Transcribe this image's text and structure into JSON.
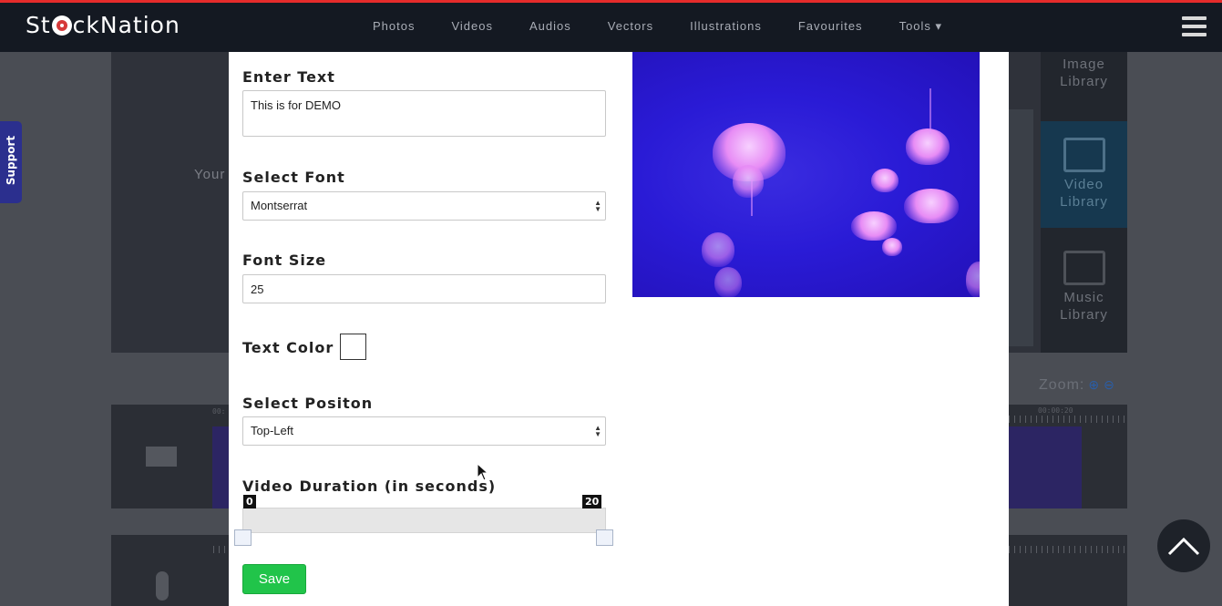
{
  "header": {
    "logo_text_pre": "St",
    "logo_text_post": "ckNation",
    "nav": [
      "Photos",
      "Videos",
      "Audios",
      "Vectors",
      "Illustrations",
      "Favourites",
      "Tools ▾"
    ]
  },
  "support_label": "Support",
  "background": {
    "left_text": "Your",
    "libraries": [
      "Image Library",
      "Video Library",
      "Music Library"
    ],
    "active_library": "Video Library",
    "zoom_label": "Zoom:",
    "time_left": "00:",
    "time_right": "00:00:20"
  },
  "form": {
    "enter_text_label": "Enter Text",
    "enter_text_value": "This is for DEMO",
    "select_font_label": "Select Font",
    "select_font_value": "Montserrat",
    "font_size_label": "Font Size",
    "font_size_value": "25",
    "text_color_label": "Text Color",
    "text_color_value": "#ffffff",
    "select_position_label": "Select Positon",
    "select_position_value": "Top-Left",
    "video_duration_label": "Video Duration (in seconds)",
    "duration_min": "0",
    "duration_max": "20",
    "save_label": "Save"
  },
  "colors": {
    "accent_green": "#21c44a",
    "top_border": "#e52b2b",
    "support_bg": "#2b2f8e"
  }
}
